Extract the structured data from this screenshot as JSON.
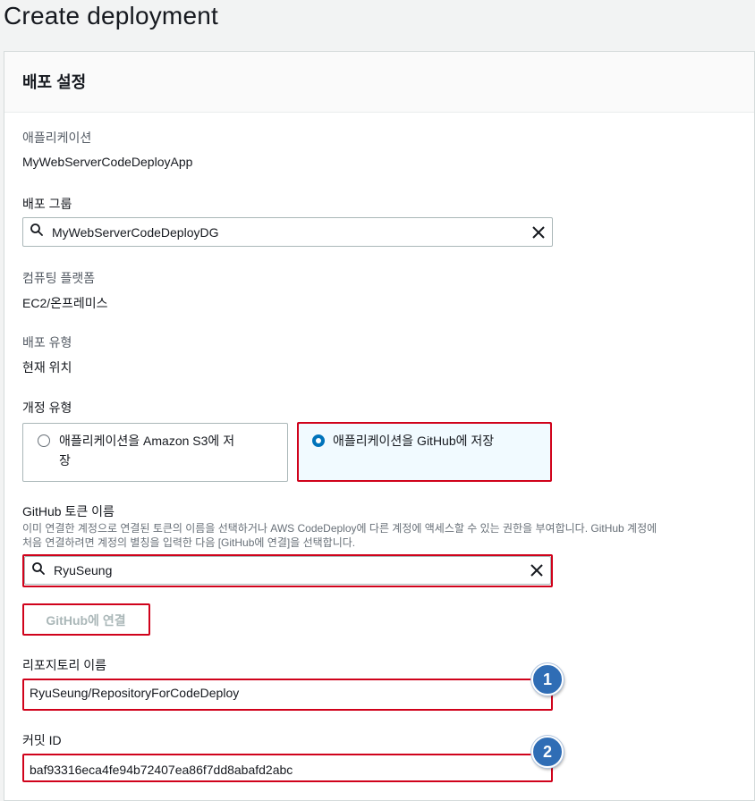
{
  "page_title": "Create deployment",
  "panel": {
    "title": "배포 설정",
    "application": {
      "label": "애플리케이션",
      "value": "MyWebServerCodeDeployApp"
    },
    "deployment_group": {
      "label": "배포 그룹",
      "value": "MyWebServerCodeDeployDG"
    },
    "compute_platform": {
      "label": "컴퓨팅 플랫폼",
      "value": "EC2/온프레미스"
    },
    "deployment_type": {
      "label": "배포 유형",
      "value": "현재 위치"
    },
    "revision_type": {
      "label": "개정 유형",
      "options": [
        {
          "label_line1": "애플리케이션을 Amazon S3에 저",
          "label_line2": "장",
          "selected": false
        },
        {
          "label_line1": "애플리케이션을 GitHub에 저장",
          "selected": true
        }
      ]
    },
    "github_token": {
      "label": "GitHub 토큰 이름",
      "description_line1": "이미 연결한 계정으로 연결된 토큰의 이름을 선택하거나 AWS CodeDeploy에 다른 계정에 액세스할 수 있는 권한을 부여합니다. GitHub 계정에",
      "description_line2": "처음 연결하려면 계정의 별칭을 입력한 다음 [GitHub에 연결]을 선택합니다.",
      "value": "RyuSeung"
    },
    "connect_button": "GitHub에 연결",
    "repository": {
      "label": "리포지토리 이름",
      "value": "RyuSeung/RepositoryForCodeDeploy",
      "badge": "1"
    },
    "commit": {
      "label": "커밋 ID",
      "value": "baf93316eca4fe94b72407ea86f7dd8abafd2abc",
      "badge": "2"
    }
  },
  "colors": {
    "highlight": "#d0021b",
    "badge": "#2f6db5",
    "accent": "#0073bb"
  }
}
